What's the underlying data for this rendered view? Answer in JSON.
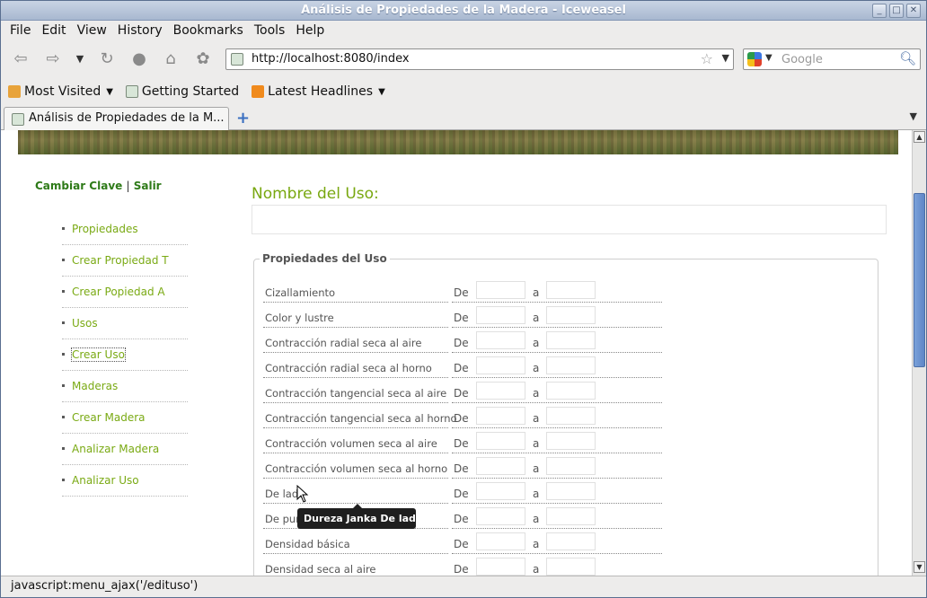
{
  "window": {
    "title": "Análisis de Propiedades de la Madera - Iceweasel"
  },
  "menu": [
    "File",
    "Edit",
    "View",
    "History",
    "Bookmarks",
    "Tools",
    "Help"
  ],
  "url": "http://localhost:8080/index",
  "search": {
    "placeholder": "Google"
  },
  "bookmarks": [
    {
      "label": "Most Visited",
      "has_caret": true
    },
    {
      "label": "Getting Started",
      "has_caret": false
    },
    {
      "label": "Latest Headlines",
      "has_caret": true
    }
  ],
  "tab": {
    "label": "Análisis de Propiedades de la M..."
  },
  "page": {
    "top_links": {
      "change_key": "Cambiar Clave",
      "separator": "|",
      "logout": "Salir"
    },
    "sidebar": [
      {
        "label": "Propiedades"
      },
      {
        "label": "Crear Propiedad T"
      },
      {
        "label": "Crear Popiedad A"
      },
      {
        "label": "Usos"
      },
      {
        "label": "Crear Uso",
        "active": true
      },
      {
        "label": "Maderas"
      },
      {
        "label": "Crear Madera"
      },
      {
        "label": "Analizar Madera"
      },
      {
        "label": "Analizar Uso"
      }
    ],
    "form": {
      "title": "Nombre del Uso:",
      "name_value": "",
      "legend": "Propiedades del Uso",
      "from_label": "De",
      "to_label": "a",
      "properties": [
        "Cizallamiento",
        "Color y lustre",
        "Contracción radial seca al aire",
        "Contracción radial seca al horno",
        "Contracción tangencial seca al aire",
        "Contracción tangencial seca al horno",
        "Contracción volumen seca al aire",
        "Contracción volumen seca al horno",
        "De lado",
        "De punta",
        "Densidad básica",
        "Densidad seca al aire"
      ]
    },
    "tooltip": "Dureza Janka De lado"
  },
  "status": "javascript:menu_ajax('/edituso')"
}
